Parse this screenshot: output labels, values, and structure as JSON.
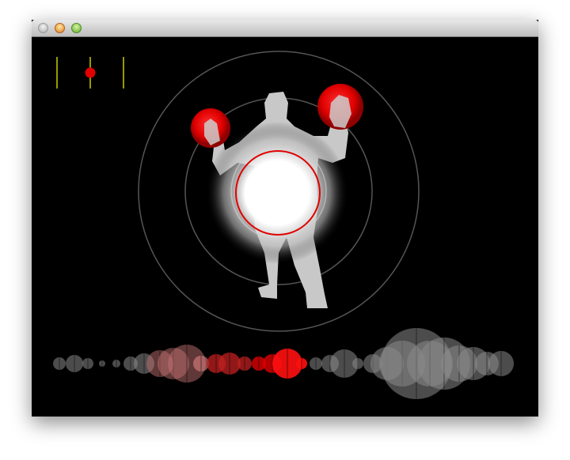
{
  "window": {
    "title": ""
  },
  "colors": {
    "background": "#000000",
    "marker": "#e00000",
    "guide_lines": "#ffff00",
    "rings": "#555555",
    "silhouette": "#c8c8c8",
    "bubble_gray": "#8a8a8a",
    "bubble_red": "#ff1010"
  },
  "icons": [
    "close-button-icon",
    "minimize-button-icon",
    "zoom-button-icon"
  ]
}
